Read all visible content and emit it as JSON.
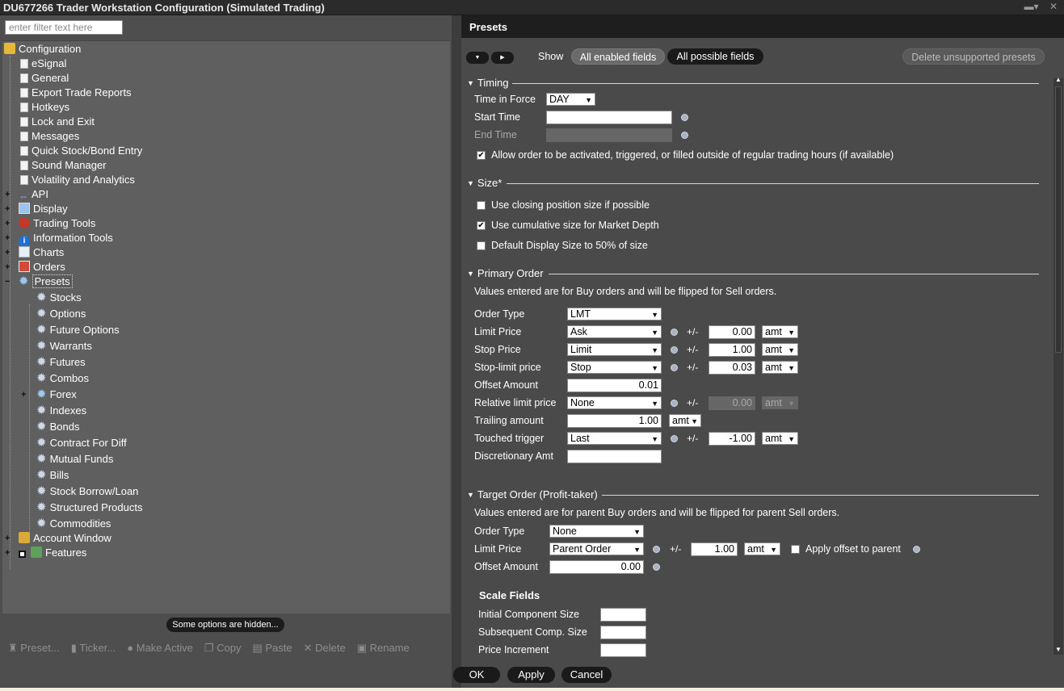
{
  "window": {
    "title": "DU677266 Trader Workstation Configuration (Simulated Trading)",
    "controls": [
      "pin-icon",
      "close-icon"
    ]
  },
  "left": {
    "filter_placeholder": "enter filter text here",
    "tree": {
      "root": "Configuration",
      "docs": [
        "eSignal",
        "General",
        "Export Trade Reports",
        "Hotkeys",
        "Lock and Exit",
        "Messages",
        "Quick Stock/Bond Entry",
        "Sound Manager",
        "Volatility and Analytics"
      ],
      "groups": [
        "API",
        "Display",
        "Trading Tools",
        "Information Tools",
        "Charts",
        "Orders"
      ],
      "presets_label": "Presets",
      "preset_children": [
        "Stocks",
        "Options",
        "Future Options",
        "Warrants",
        "Futures",
        "Combos",
        "Forex",
        "Indexes",
        "Bonds",
        "Contract For Diff",
        "Mutual Funds",
        "Bills",
        "Stock Borrow/Loan",
        "Structured Products",
        "Commodities"
      ],
      "after": [
        "Account Window",
        "Features"
      ]
    },
    "hidden_options_label": "Some options are hidden...",
    "tools": [
      "Preset...",
      "Ticker...",
      "Make Active",
      "Copy",
      "Paste",
      "Delete",
      "Rename"
    ]
  },
  "right": {
    "header": "Presets",
    "show_label": "Show",
    "show_options": [
      "All enabled fields",
      "All possible fields"
    ],
    "delete_unsupported": "Delete unsupported presets",
    "timing": {
      "title": "Timing",
      "tif_label": "Time in Force",
      "tif_value": "DAY",
      "start_label": "Start Time",
      "end_label": "End Time",
      "outside_rth": "Allow order to be activated, triggered, or filled outside of regular trading hours (if available)",
      "outside_rth_checked": true
    },
    "size": {
      "title": "Size*",
      "opt1": "Use closing position size if possible",
      "opt2": "Use cumulative size for Market Depth",
      "opt3": "Default Display Size to 50% of size",
      "checked": [
        false,
        true,
        false
      ]
    },
    "primary": {
      "title": "Primary Order",
      "note": "Values entered are for Buy orders and will be flipped for Sell orders.",
      "pm": "+/-",
      "order_type_label": "Order Type",
      "order_type": "LMT",
      "limit_label": "Limit Price",
      "limit_ref": "Ask",
      "limit_off": "0.00",
      "limit_unit": "amt",
      "stop_label": "Stop Price",
      "stop_ref": "Limit",
      "stop_off": "1.00",
      "stop_unit": "amt",
      "stoplimit_label": "Stop-limit price",
      "stoplimit_ref": "Stop",
      "stoplimit_off": "0.03",
      "stoplimit_unit": "amt",
      "offset_label": "Offset Amount",
      "offset_value": "0.01",
      "rel_label": "Relative limit price",
      "rel_ref": "None",
      "rel_off": "0.00",
      "rel_unit": "amt",
      "trail_label": "Trailing amount",
      "trail_value": "1.00",
      "trail_unit": "amt",
      "touched_label": "Touched trigger",
      "touched_ref": "Last",
      "touched_off": "-1.00",
      "touched_unit": "amt",
      "disc_label": "Discretionary Amt"
    },
    "target": {
      "title": "Target Order (Profit-taker)",
      "note": "Values entered are for parent Buy orders and will be flipped for parent Sell orders.",
      "order_type_label": "Order Type",
      "order_type": "None",
      "limit_label": "Limit Price",
      "limit_ref": "Parent Order",
      "pm": "+/-",
      "limit_off": "1.00",
      "limit_unit": "amt",
      "apply_offset": "Apply offset to parent",
      "offset_label": "Offset Amount",
      "offset_value": "0.00"
    },
    "scale": {
      "title": "Scale Fields",
      "initial": "Initial Component Size",
      "subsequent": "Subsequent Comp. Size",
      "increment": "Price Increment"
    },
    "buttons": {
      "ok": "OK",
      "apply": "Apply",
      "cancel": "Cancel"
    }
  }
}
